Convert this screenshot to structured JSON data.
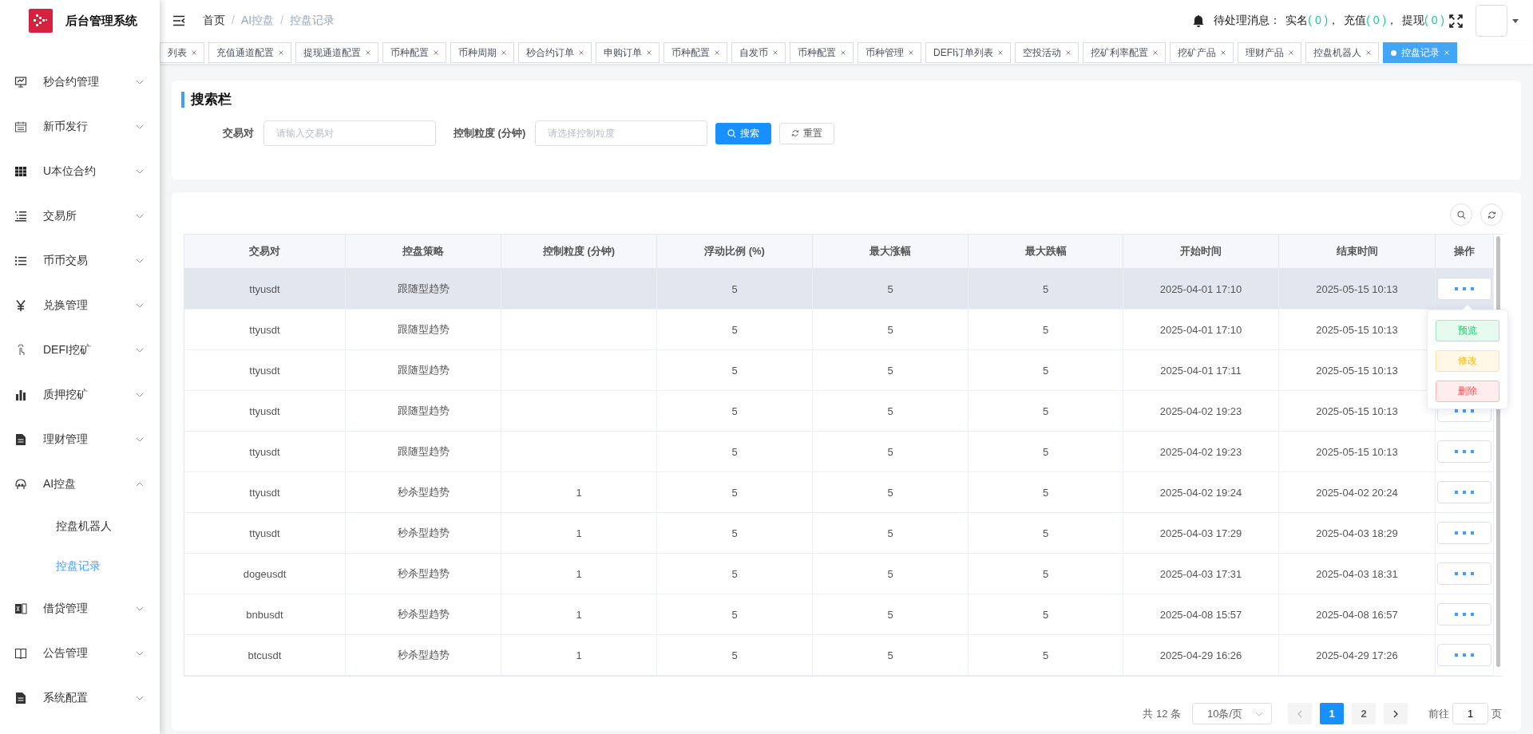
{
  "app": {
    "title": "后台管理系统"
  },
  "sidebar": {
    "items": [
      {
        "label": "秒合约管理",
        "expanded": false
      },
      {
        "label": "新币发行",
        "expanded": false
      },
      {
        "label": "U本位合约",
        "expanded": false
      },
      {
        "label": "交易所",
        "expanded": false
      },
      {
        "label": "币币交易",
        "expanded": false
      },
      {
        "label": "兑换管理",
        "expanded": false
      },
      {
        "label": "DEFI挖矿",
        "expanded": false
      },
      {
        "label": "质押挖矿",
        "expanded": false
      },
      {
        "label": "理财管理",
        "expanded": false
      },
      {
        "label": "AI控盘",
        "expanded": true,
        "children": [
          {
            "label": "控盘机器人",
            "selected": false
          },
          {
            "label": "控盘记录",
            "selected": true
          }
        ]
      },
      {
        "label": "借贷管理",
        "expanded": false
      },
      {
        "label": "公告管理",
        "expanded": false
      },
      {
        "label": "系统配置",
        "expanded": false
      }
    ]
  },
  "breadcrumb": {
    "separator": "/",
    "items": [
      "首页",
      "AI控盘",
      "控盘记录"
    ]
  },
  "header": {
    "notice_label": "待处理消息：",
    "separator": "，",
    "notices": [
      {
        "label": "实名",
        "count": "( 0 )"
      },
      {
        "label": "充值",
        "count": "( 0 )"
      },
      {
        "label": "提现",
        "count": "( 0 )"
      }
    ]
  },
  "tabs": [
    {
      "label": "列表",
      "selected": false
    },
    {
      "label": "充值通道配置",
      "selected": false
    },
    {
      "label": "提现通道配置",
      "selected": false
    },
    {
      "label": "币种配置",
      "selected": false
    },
    {
      "label": "币种周期",
      "selected": false
    },
    {
      "label": "秒合约订单",
      "selected": false
    },
    {
      "label": "申购订单",
      "selected": false
    },
    {
      "label": "币种配置",
      "selected": false
    },
    {
      "label": "自发币",
      "selected": false
    },
    {
      "label": "币种配置",
      "selected": false
    },
    {
      "label": "币种管理",
      "selected": false
    },
    {
      "label": "DEFI订单列表",
      "selected": false
    },
    {
      "label": "空投活动",
      "selected": false
    },
    {
      "label": "挖矿利率配置",
      "selected": false
    },
    {
      "label": "挖矿产品",
      "selected": false
    },
    {
      "label": "理财产品",
      "selected": false
    },
    {
      "label": "控盘机器人",
      "selected": false
    },
    {
      "label": "控盘记录",
      "selected": true
    }
  ],
  "search": {
    "title": "搜索栏",
    "fields": [
      {
        "label": "交易对",
        "placeholder": "请输入交易对"
      },
      {
        "label": "控制粒度 (分钟)",
        "placeholder": "请选择控制粒度"
      }
    ],
    "search_button": "搜索",
    "reset_button": "重置"
  },
  "table": {
    "columns": [
      "交易对",
      "控盘策略",
      "控制粒度 (分钟)",
      "浮动比例 (%)",
      "最大涨幅",
      "最大跌幅",
      "开始时间",
      "结束时间",
      "操作"
    ],
    "rows": [
      {
        "hovered": true,
        "cells": [
          "ttyusdt",
          "跟随型趋势",
          "",
          "5",
          "5",
          "5",
          "2025-04-01 17:10",
          "2025-05-15 10:13"
        ]
      },
      {
        "hovered": false,
        "cells": [
          "ttyusdt",
          "跟随型趋势",
          "",
          "5",
          "5",
          "5",
          "2025-04-01 17:10",
          "2025-05-15 10:13"
        ]
      },
      {
        "hovered": false,
        "cells": [
          "ttyusdt",
          "跟随型趋势",
          "",
          "5",
          "5",
          "5",
          "2025-04-01 17:11",
          "2025-05-15 10:13"
        ]
      },
      {
        "hovered": false,
        "cells": [
          "ttyusdt",
          "跟随型趋势",
          "",
          "5",
          "5",
          "5",
          "2025-04-02 19:23",
          "2025-05-15 10:13"
        ]
      },
      {
        "hovered": false,
        "cells": [
          "ttyusdt",
          "跟随型趋势",
          "",
          "5",
          "5",
          "5",
          "2025-04-02 19:23",
          "2025-05-15 10:13"
        ]
      },
      {
        "hovered": false,
        "cells": [
          "ttyusdt",
          "秒杀型趋势",
          "1",
          "5",
          "5",
          "5",
          "2025-04-02 19:24",
          "2025-04-02 20:24"
        ]
      },
      {
        "hovered": false,
        "cells": [
          "ttyusdt",
          "秒杀型趋势",
          "1",
          "5",
          "5",
          "5",
          "2025-04-03 17:29",
          "2025-04-03 18:29"
        ]
      },
      {
        "hovered": false,
        "cells": [
          "dogeusdt",
          "秒杀型趋势",
          "1",
          "5",
          "5",
          "5",
          "2025-04-03 17:31",
          "2025-04-03 18:31"
        ]
      },
      {
        "hovered": false,
        "cells": [
          "bnbusdt",
          "秒杀型趋势",
          "1",
          "5",
          "5",
          "5",
          "2025-04-08 15:57",
          "2025-04-08 16:57"
        ]
      },
      {
        "hovered": false,
        "cells": [
          "btcusdt",
          "秒杀型趋势",
          "1",
          "5",
          "5",
          "5",
          "2025-04-29 16:26",
          "2025-04-29 17:26"
        ]
      }
    ]
  },
  "row_menu": [
    {
      "label": "预览",
      "kind": "view"
    },
    {
      "label": "修改",
      "kind": "edit"
    },
    {
      "label": "删除",
      "kind": "delete"
    }
  ],
  "pagination": {
    "total": "共 12 条",
    "page_size": "10条/页",
    "pages": [
      {
        "label": "1",
        "selected": true
      },
      {
        "label": "2",
        "selected": false
      }
    ],
    "prev_disabled": true,
    "goto_label": "前往",
    "goto_value": "1",
    "goto_suffix": "页"
  }
}
